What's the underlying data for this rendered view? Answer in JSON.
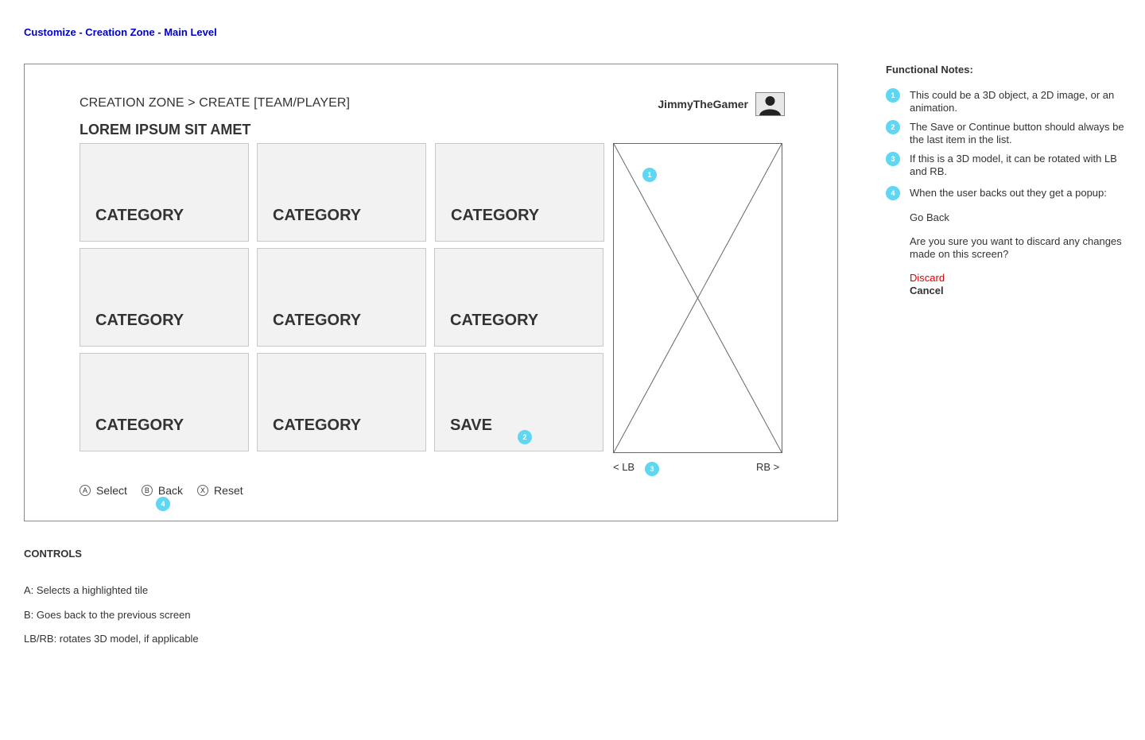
{
  "page": {
    "title": "Customize - Creation Zone - Main Level"
  },
  "screen": {
    "breadcrumb": "CREATION ZONE > CREATE [TEAM/PLAYER]",
    "heading": "LOREM IPSUM SIT AMET",
    "username": "JimmyTheGamer",
    "tiles": [
      {
        "label": "CATEGORY"
      },
      {
        "label": "CATEGORY"
      },
      {
        "label": "CATEGORY"
      },
      {
        "label": "CATEGORY"
      },
      {
        "label": "CATEGORY"
      },
      {
        "label": "CATEGORY"
      },
      {
        "label": "CATEGORY"
      },
      {
        "label": "CATEGORY"
      },
      {
        "label": "SAVE"
      }
    ],
    "lb_label": "< LB",
    "rb_label": "RB >",
    "controls": [
      {
        "glyph": "A",
        "label": "Select"
      },
      {
        "glyph": "B",
        "label": "Back"
      },
      {
        "glyph": "X",
        "label": "Reset"
      }
    ],
    "markers": [
      "1",
      "2",
      "3",
      "4"
    ]
  },
  "notes": {
    "title": "Functional Notes:",
    "items": [
      {
        "num": "1",
        "text": "This could be a 3D object, a 2D image, or an animation."
      },
      {
        "num": "2",
        "text": "The Save or Continue button should always be the last item in the list."
      },
      {
        "num": "3",
        "text": "If this is a 3D model, it can be rotated with LB and RB."
      },
      {
        "num": "4",
        "text": "When the user backs out they get a popup:"
      }
    ],
    "popup": {
      "title": "Go Back",
      "message": "Are you sure you want to discard any changes made on this screen?",
      "discard": "Discard",
      "cancel": "Cancel"
    }
  },
  "controls_section": {
    "title": "CONTROLS",
    "items": [
      "A: Selects a highlighted tile",
      "B: Goes back to the previous screen",
      "LB/RB: rotates 3D model, if applicable"
    ]
  },
  "colors": {
    "title": "#0000cc",
    "marker": "#5fd7f2",
    "discard": "#e00000",
    "tile": "#f2f2f2"
  },
  "icons": {
    "avatar": "user-silhouette-icon",
    "preview": "image-placeholder-icon"
  }
}
